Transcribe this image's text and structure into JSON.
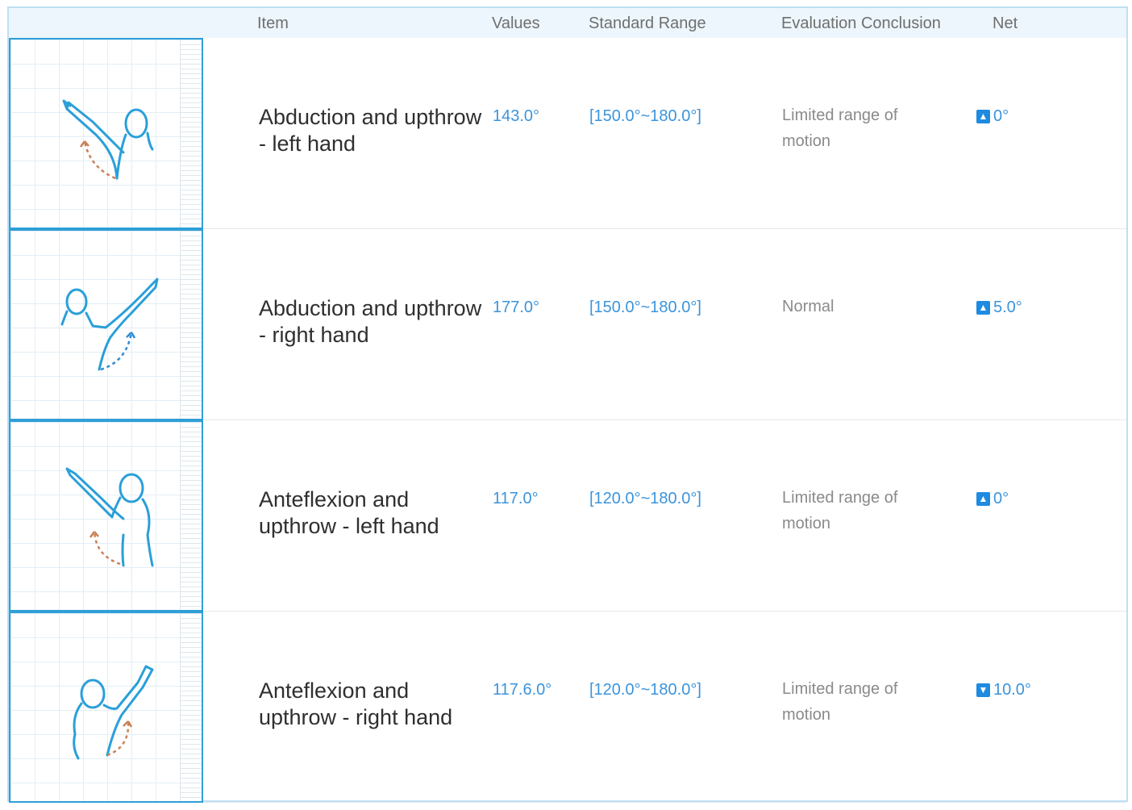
{
  "header": {
    "item": "Item",
    "values": "Values",
    "standard_range": "Standard Range",
    "evaluation": "Evaluation Conclusion",
    "net": "Net"
  },
  "rows": [
    {
      "item": "Abduction and upthrow - left hand",
      "value": "143.0°",
      "range": "[150.0°~180.0°]",
      "conclusion": "Limited range of motion",
      "net_direction": "up",
      "net_icon": "arrow-up-icon",
      "net": "0°",
      "figure_icon": "abduction-left-figure-icon",
      "arc_color": "#c98157"
    },
    {
      "item": "Abduction and upthrow - right hand",
      "value": "177.0°",
      "range": "[150.0°~180.0°]",
      "conclusion": "Normal",
      "net_direction": "up",
      "net_icon": "arrow-up-icon",
      "net": "5.0°",
      "figure_icon": "abduction-right-figure-icon",
      "arc_color": "#2e8bd2"
    },
    {
      "item": "Anteflexion and upthrow - left hand",
      "value": "117.0°",
      "range": "[120.0°~180.0°]",
      "conclusion": "Limited range of motion",
      "net_direction": "up",
      "net_icon": "arrow-up-icon",
      "net": "0°",
      "figure_icon": "anteflexion-left-figure-icon",
      "arc_color": "#c98157"
    },
    {
      "item": "Anteflexion and upthrow - right hand",
      "value": "117.6.0°",
      "range": "[120.0°~180.0°]",
      "conclusion": "Limited range of motion",
      "net_direction": "down",
      "net_icon": "arrow-down-icon",
      "net": "10.0°",
      "figure_icon": "anteflexion-right-figure-icon",
      "arc_color": "#c98157"
    }
  ],
  "colors": {
    "accent": "#3b94dc",
    "tile_border": "#2f9fd8",
    "figure_stroke": "#2a9fd9",
    "header_bg": "#edf6fc"
  }
}
